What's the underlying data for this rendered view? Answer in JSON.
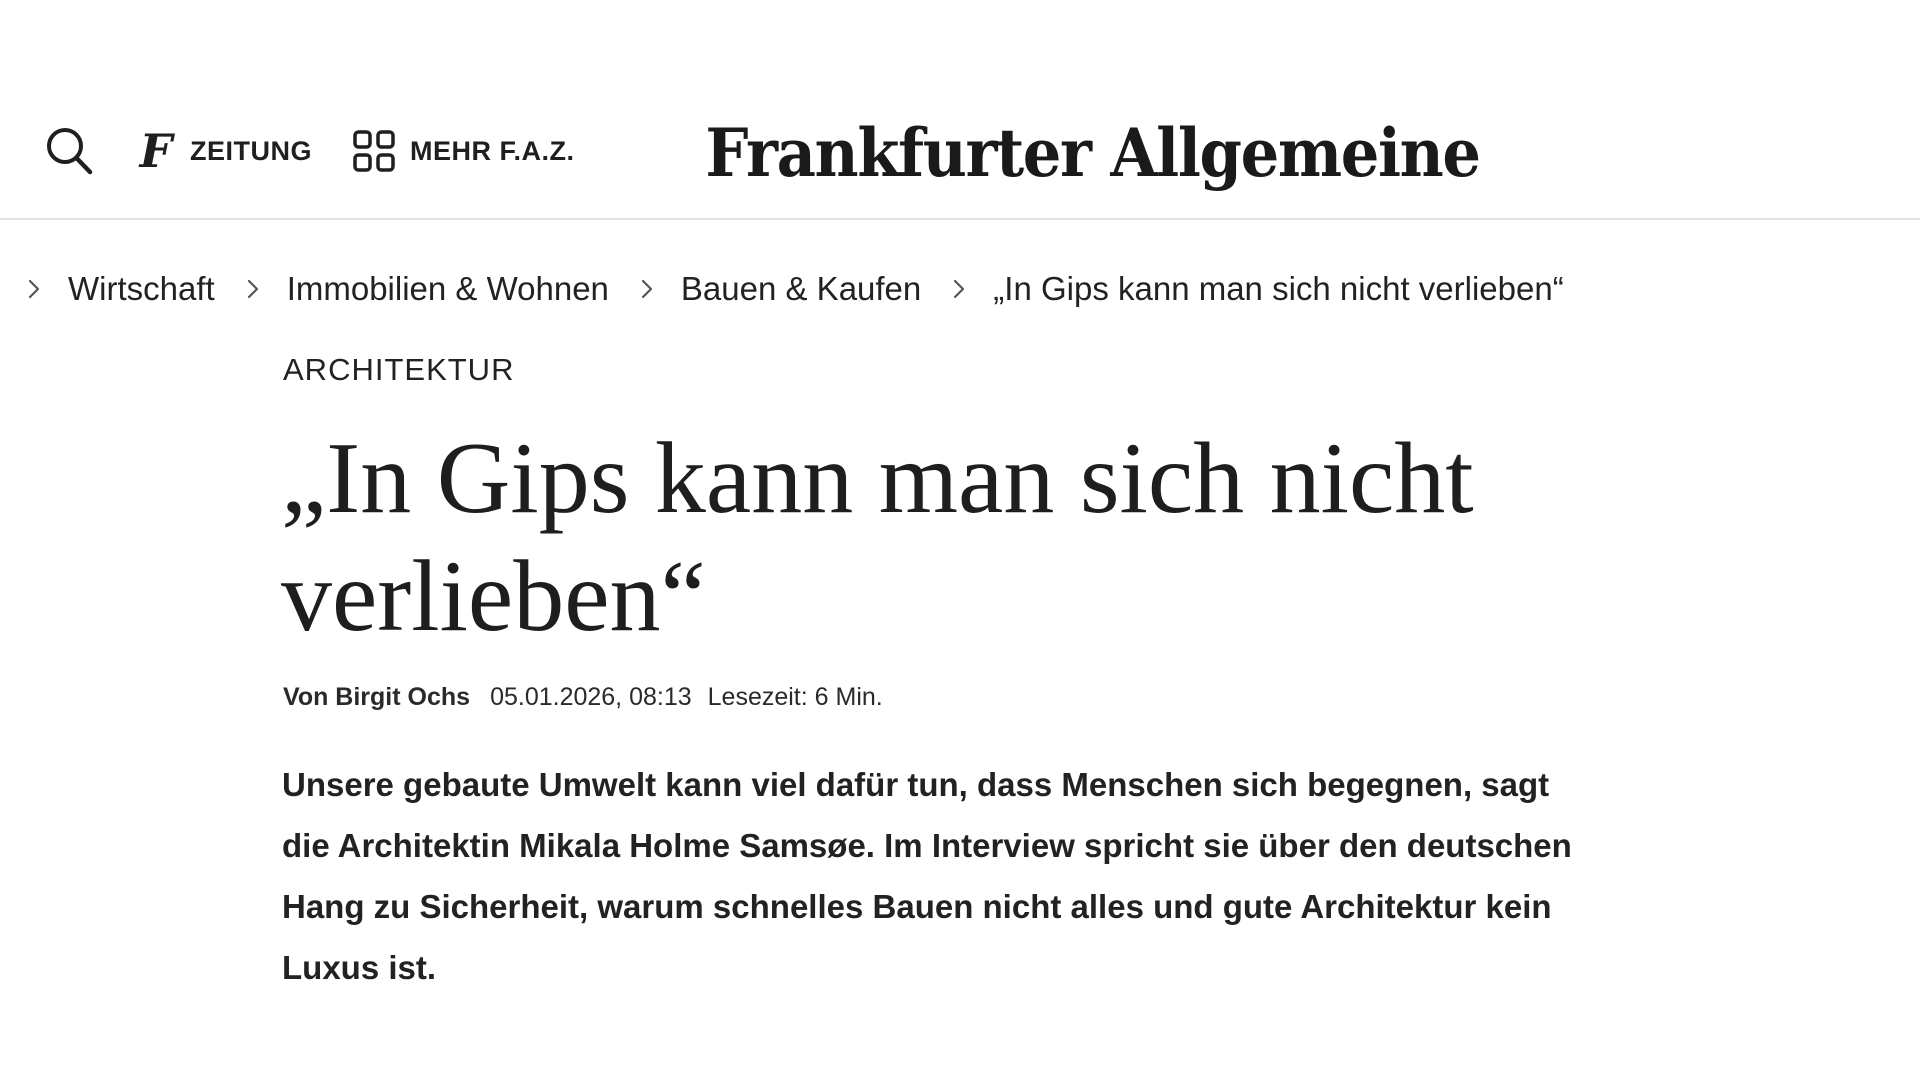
{
  "header": {
    "zeitung_label": "ZEITUNG",
    "mehr_label": "MEHR F.A.Z.",
    "logo_text": "Frankfurter Allgemeine",
    "zeitung_glyph": "F",
    "icons": {
      "search": "search-icon",
      "zeitung": "faz-f-icon",
      "mehr": "grid-icon"
    }
  },
  "breadcrumb": {
    "items": [
      {
        "label": "Wirtschaft"
      },
      {
        "label": "Immobilien & Wohnen"
      },
      {
        "label": "Bauen & Kaufen"
      },
      {
        "label": "„In Gips kann man sich nicht verlieben“"
      }
    ]
  },
  "article": {
    "kicker": "ARCHITEKTUR",
    "headline": "„In Gips kann man sich nicht verlieben“",
    "author": "Von Birgit Ochs",
    "date": "05.01.2026, 08:13",
    "reading_time": "Lesezeit: 6 Min.",
    "teaser": "Unsere gebaute Umwelt kann viel dafür tun, dass Menschen sich begegnen, sagt die Architektin Mikala Holme Samsøe. Im Interview spricht sie über den deutschen Hang zu Sicherheit, warum schnelles Bauen nicht alles und gute Architektur kein Luxus ist."
  }
}
